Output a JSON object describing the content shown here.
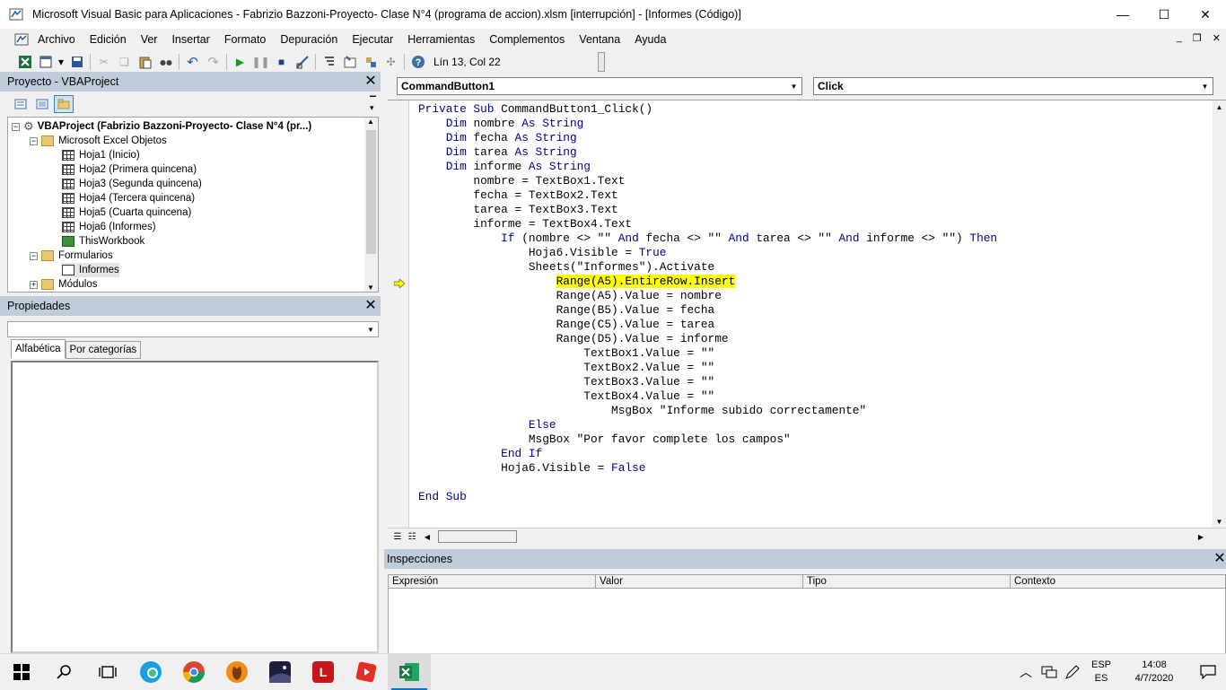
{
  "window": {
    "title": "Microsoft Visual Basic para Aplicaciones - Fabrizio Bazzoni-Proyecto- Clase N°4 (programa de accion).xlsm [interrupción] - [Informes (Código)]",
    "minimize_glyph": "—",
    "maximize_glyph": "☐",
    "close_glyph": "✕"
  },
  "menu": {
    "items": [
      "Archivo",
      "Edición",
      "Ver",
      "Insertar",
      "Formato",
      "Depuración",
      "Ejecutar",
      "Herramientas",
      "Complementos",
      "Ventana",
      "Ayuda"
    ],
    "mdi_min": "_",
    "mdi_restore": "❐",
    "mdi_close": "✕"
  },
  "toolbar": {
    "position": "Lín 13, Col 22",
    "icons": [
      "excel-view-icon",
      "insert-module-icon",
      "save-icon",
      "cut-icon",
      "copy-icon",
      "paste-icon",
      "find-icon",
      "undo-icon",
      "redo-icon",
      "run-icon",
      "break-icon",
      "reset-icon",
      "design-mode-icon",
      "project-explorer-icon",
      "properties-window-icon",
      "object-browser-icon",
      "toolbox-icon",
      "help-icon"
    ]
  },
  "project_panel": {
    "title": "Proyecto - VBAProject",
    "root": "VBAProject (Fabrizio Bazzoni-Proyecto- Clase N°4 (pr...)",
    "folder_excel": "Microsoft Excel Objetos",
    "sheets": [
      "Hoja1 (Inicio)",
      "Hoja2 (Primera quincena)",
      "Hoja3 (Segunda quincena)",
      "Hoja4 (Tercera quincena)",
      "Hoja5 (Cuarta quincena)",
      "Hoja6 (Informes)"
    ],
    "workbook": "ThisWorkbook",
    "folder_forms": "Formularios",
    "form": "Informes",
    "folder_modules": "Módulos",
    "expander_open": "−",
    "expander_closed": "+"
  },
  "props_panel": {
    "title": "Propiedades",
    "tabs": [
      "Alfabética",
      "Por categorías"
    ],
    "combo_value": ""
  },
  "code_window": {
    "object_combo": "CommandButton1",
    "proc_combo": "Click",
    "lines": [
      [
        {
          "t": "Private Sub ",
          "k": true
        },
        {
          "t": "CommandButton1_Click()"
        }
      ],
      [
        {
          "t": "    "
        },
        {
          "t": "Dim ",
          "k": true
        },
        {
          "t": "nombre "
        },
        {
          "t": "As String",
          "k": true
        }
      ],
      [
        {
          "t": "    "
        },
        {
          "t": "Dim ",
          "k": true
        },
        {
          "t": "fecha "
        },
        {
          "t": "As String",
          "k": true
        }
      ],
      [
        {
          "t": "    "
        },
        {
          "t": "Dim ",
          "k": true
        },
        {
          "t": "tarea "
        },
        {
          "t": "As String",
          "k": true
        }
      ],
      [
        {
          "t": "    "
        },
        {
          "t": "Dim ",
          "k": true
        },
        {
          "t": "informe "
        },
        {
          "t": "As String",
          "k": true
        }
      ],
      [
        {
          "t": "        nombre = TextBox1.Text"
        }
      ],
      [
        {
          "t": "        fecha = TextBox2.Text"
        }
      ],
      [
        {
          "t": "        tarea = TextBox3.Text"
        }
      ],
      [
        {
          "t": "        informe = TextBox4.Text"
        }
      ],
      [
        {
          "t": "            "
        },
        {
          "t": "If ",
          "k": true
        },
        {
          "t": "(nombre <> \"\" "
        },
        {
          "t": "And ",
          "k": true
        },
        {
          "t": "fecha <> \"\" "
        },
        {
          "t": "And ",
          "k": true
        },
        {
          "t": "tarea <> \"\" "
        },
        {
          "t": "And ",
          "k": true
        },
        {
          "t": "informe <> \"\") "
        },
        {
          "t": "Then",
          "k": true
        }
      ],
      [
        {
          "t": "                Hoja6.Visible = "
        },
        {
          "t": "True",
          "k": true
        }
      ],
      [
        {
          "t": "                Sheets(\"Informes\").Activate"
        }
      ],
      [
        {
          "t": "                    "
        },
        {
          "t": "Range(A5).EntireRow.Insert",
          "h": true
        }
      ],
      [
        {
          "t": "                    Range(A5).Value = nombre"
        }
      ],
      [
        {
          "t": "                    Range(B5).Value = fecha"
        }
      ],
      [
        {
          "t": "                    Range(C5).Value = tarea"
        }
      ],
      [
        {
          "t": "                    Range(D5).Value = informe"
        }
      ],
      [
        {
          "t": "                        TextBox1.Value = \"\""
        }
      ],
      [
        {
          "t": "                        TextBox2.Value = \"\""
        }
      ],
      [
        {
          "t": "                        TextBox3.Value = \"\""
        }
      ],
      [
        {
          "t": "                        TextBox4.Value = \"\""
        }
      ],
      [
        {
          "t": "                            MsgBox \"Informe subido correctamente\""
        }
      ],
      [
        {
          "t": "                "
        },
        {
          "t": "Else",
          "k": true
        }
      ],
      [
        {
          "t": "                MsgBox \"Por favor complete los campos\""
        }
      ],
      [
        {
          "t": "            "
        },
        {
          "t": "End If",
          "k": true
        }
      ],
      [
        {
          "t": "            Hoja6.Visible = "
        },
        {
          "t": "False",
          "k": true
        }
      ],
      [
        {
          "t": ""
        }
      ],
      [
        {
          "t": "End Sub",
          "k": true
        }
      ]
    ],
    "colors": {
      "keyword": "#00008b",
      "highlight": "#ffff00"
    }
  },
  "watch_panel": {
    "title": "Inspecciones",
    "columns": [
      "Expresión",
      "Valor",
      "Tipo",
      "Contexto"
    ]
  },
  "taskbar": {
    "apps": [
      "start-icon",
      "search-icon",
      "task-view-icon",
      "edge-icon",
      "chrome-like-icon",
      "fl-studio-icon",
      "stellarium-icon",
      "l-app-icon",
      "video-app-icon",
      "excel-icon"
    ],
    "lang_top": "ESP",
    "lang_bottom": "ES",
    "time": "14:08",
    "date": "4/7/2020"
  }
}
